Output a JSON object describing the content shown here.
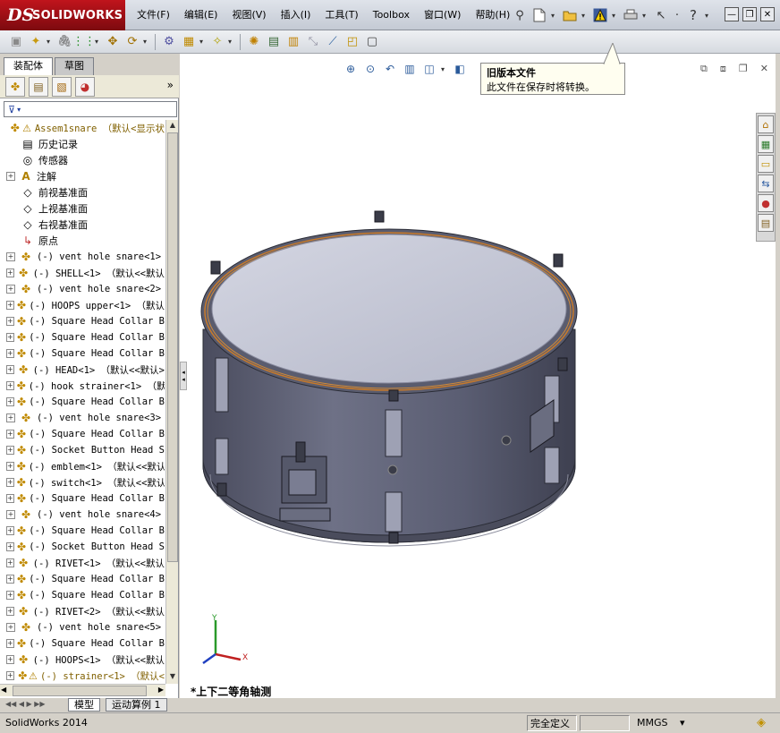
{
  "app": {
    "logo_ds": "DS",
    "logo_text": "SOLIDWORKS"
  },
  "menu": [
    "文件(F)",
    "编辑(E)",
    "视图(V)",
    "插入(I)",
    "工具(T)",
    "Toolbox",
    "窗口(W)",
    "帮助(H)"
  ],
  "panel": {
    "tabs": [
      "装配体",
      "草图"
    ],
    "more": "»"
  },
  "tree": {
    "root": "Assem1snare （默认<显示状",
    "system_items": [
      "历史记录",
      "传感器",
      "注解",
      "前视基准面",
      "上视基准面",
      "右视基准面",
      "原点"
    ],
    "components": [
      "(-) vent hole snare<1>",
      "(-) SHELL<1> （默认<<默认",
      "(-) vent hole snare<2>",
      "(-) HOOPS upper<1> （默认",
      "(-) Square Head Collar B",
      "(-) Square Head Collar B",
      "(-) Square Head Collar B",
      "(-) HEAD<1> （默认<<默认>",
      "(-) hook strainer<1> （默",
      "(-) Square Head Collar B",
      "(-) vent hole snare<3>",
      "(-) Square Head Collar B",
      "(-) Socket Button Head S",
      "(-) emblem<1> （默认<<默认",
      "(-) switch<1> （默认<<默认",
      "(-) Square Head Collar B",
      "(-) vent hole snare<4>",
      "(-) Square Head Collar B",
      "(-) Socket Button Head S",
      "(-) RIVET<1> （默认<<默认",
      "(-) Square Head Collar B",
      "(-) Square Head Collar B",
      "(-) RIVET<2> （默认<<默认",
      "(-) vent hole snare<5>",
      "(-) Square Head Collar B",
      "(-) HOOPS<1> （默认<<默认",
      "(-) strainer<1> （默认<"
    ]
  },
  "tooltip": {
    "title": "旧版本文件",
    "body": "此文件在保存时将转换。"
  },
  "viewport": {
    "view_name": "*上下二等角轴测",
    "triad_x": "X",
    "triad_y": "Y"
  },
  "bottom_tabs": [
    "模型",
    "运动算例 1"
  ],
  "status": {
    "version": "SolidWorks 2014",
    "definition": "完全定义",
    "units": "MMGS",
    "units_caret": "▾"
  },
  "colors": {
    "logo_red": "#b01018",
    "drum_shell": "#6a6d82",
    "drum_head": "#c4c6d6",
    "hoop_orange": "#c87a2a"
  }
}
